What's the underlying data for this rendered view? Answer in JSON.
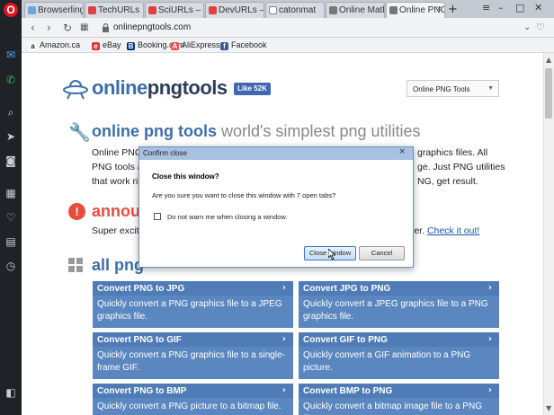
{
  "browser": {
    "logo": "O",
    "tabs": [
      {
        "label": "Browserling",
        "color": "#6aa7e0",
        "active": false
      },
      {
        "label": "TechURLs",
        "color": "#e04040",
        "active": false
      },
      {
        "label": "SciURLs – Sci",
        "color": "#e04040",
        "active": false
      },
      {
        "label": "DevURLs – Dev",
        "color": "#e04040",
        "active": false
      },
      {
        "label": "catonmat",
        "color": "#ffffff",
        "active": false
      },
      {
        "label": "Online Math",
        "color": "#555555",
        "active": false
      },
      {
        "label": "Online PNG",
        "color": "#555555",
        "active": true
      }
    ],
    "new_tab": "+",
    "url": "onlinepngtools.com",
    "bookmarks": [
      {
        "label": "Amazon.ca",
        "icon": "a",
        "color": "#222222"
      },
      {
        "label": "eBay",
        "icon": "e",
        "color": "#e53238"
      },
      {
        "label": "Booking.com",
        "icon": "B",
        "color": "#003580"
      },
      {
        "label": "AliExpress",
        "icon": "A",
        "color": "#ff4747"
      },
      {
        "label": "Facebook",
        "icon": "f",
        "color": "#3b5998"
      }
    ]
  },
  "page": {
    "logo_part1": "online",
    "logo_part2": "pngtools",
    "fb_like": "Like 52K",
    "tool_select": "Online PNG Tools",
    "heading_main": "online png tools",
    "heading_rest": " world's simplest png utilities",
    "intro_line1": "Online PNG",
    "intro_line1_right": "graphics files. All",
    "intro_line2": "PNG tools a",
    "intro_line2_right": "ge. Just PNG utilities",
    "intro_line3": "that work rig",
    "intro_line3_right": "NG, get result.",
    "announce_heading": "announ",
    "announce_line": "Super exciti",
    "announce_right": "ler.",
    "announce_link": "Check it out!",
    "all_tools_heading": "all png",
    "cards": [
      {
        "title": "Convert PNG to JPG",
        "desc": "Quickly convert a PNG graphics file to a JPEG graphics file."
      },
      {
        "title": "Convert JPG to PNG",
        "desc": "Quickly convert a JPEG graphics file to a PNG graphics file."
      },
      {
        "title": "Convert PNG to GIF",
        "desc": "Quickly convert a PNG graphics file to a single-frame GIF."
      },
      {
        "title": "Convert GIF to PNG",
        "desc": "Quickly convert a GIF animation to a PNG picture."
      },
      {
        "title": "Convert PNG to BMP",
        "desc": "Quickly convert a PNG picture to a bitmap file."
      },
      {
        "title": "Convert BMP to PNG",
        "desc": "Quickly convert a bitmap image file to a PNG file."
      }
    ]
  },
  "dialog": {
    "title": "Confirm close",
    "heading": "Close this window?",
    "message": "Are you sure you want to close this window with 7 open tabs?",
    "checkbox_label": "Do not warn me when closing a window.",
    "checkbox_checked": false,
    "confirm": "Close window",
    "cancel": "Cancel"
  }
}
